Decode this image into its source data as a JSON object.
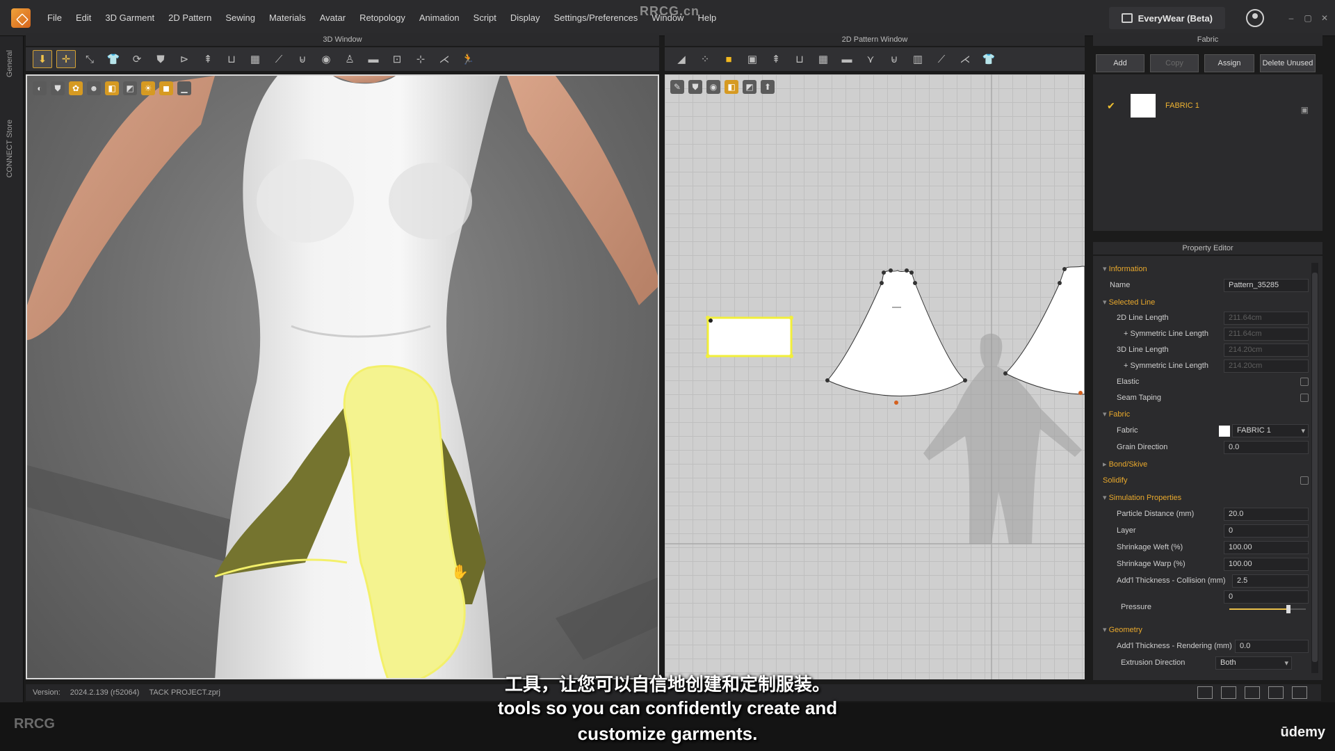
{
  "menubar": {
    "items": [
      "File",
      "Edit",
      "3D Garment",
      "2D Pattern",
      "Sewing",
      "Materials",
      "Avatar",
      "Retopology",
      "Animation",
      "Script",
      "Display",
      "Settings/Preferences",
      "Window",
      "Help"
    ],
    "watermark": "RRCG.cn",
    "everywear_label": "EveryWear (Beta)"
  },
  "sidebar": {
    "tab_general": "General",
    "tab_connect": "CONNECT Store"
  },
  "window3d": {
    "title": "3D Window"
  },
  "window2d": {
    "title": "2D Pattern Window"
  },
  "fabric_panel": {
    "title": "Fabric",
    "buttons": {
      "add": "Add",
      "copy": "Copy",
      "assign": "Assign",
      "delete_unused": "Delete Unused"
    },
    "item_name": "FABRIC 1"
  },
  "property_editor": {
    "title": "Property Editor",
    "sections": {
      "information": "Information",
      "selected_line": "Selected Line",
      "fabric": "Fabric",
      "bond_skive": "Bond/Skive",
      "solidify": "Solidify",
      "simulation": "Simulation Properties",
      "geometry": "Geometry"
    },
    "rows": {
      "name_label": "Name",
      "name_value": "Pattern_35285",
      "line2d_label": "2D Line Length",
      "line2d_value": "211.64cm",
      "sym2d_label": "+ Symmetric Line Length",
      "sym2d_value": "211.64cm",
      "line3d_label": "3D Line Length",
      "line3d_value": "214.20cm",
      "sym3d_label": "+ Symmetric Line Length",
      "sym3d_value": "214.20cm",
      "elastic_label": "Elastic",
      "seam_label": "Seam Taping",
      "fabric_label": "Fabric",
      "fabric_value": "FABRIC 1",
      "grain_label": "Grain Direction",
      "grain_value": "0.0",
      "particle_label": "Particle Distance (mm)",
      "particle_value": "20.0",
      "layer_label": "Layer",
      "layer_value": "0",
      "weft_label": "Shrinkage Weft (%)",
      "weft_value": "100.00",
      "warp_label": "Shrinkage Warp (%)",
      "warp_value": "100.00",
      "collision_label": "Add'l Thickness - Collision (mm)",
      "collision_value": "2.5",
      "pressure_label": "Pressure",
      "pressure_value": "0",
      "render_label": "Add'l Thickness - Rendering (mm)",
      "render_value": "0.0",
      "extrusion_label": "Extrusion Direction",
      "extrusion_value": "Both"
    }
  },
  "statusbar": {
    "version_label": "Version:",
    "version_value": "2024.2.139 (r52064)",
    "project": "TACK PROJECT.zprj"
  },
  "subtitles": {
    "zh": "工具，让您可以自信地创建和定制服装。",
    "en_line1": "tools so you can confidently create and",
    "en_line2": "customize garments."
  },
  "branding": {
    "udemy": "ūdemy",
    "rrcg": "RRCG"
  },
  "colors": {
    "accent": "#f2b531",
    "highlight_yellow": "#f4f26a",
    "fabric_olive": "#75742f",
    "panel_bg": "#2b2b2d"
  }
}
